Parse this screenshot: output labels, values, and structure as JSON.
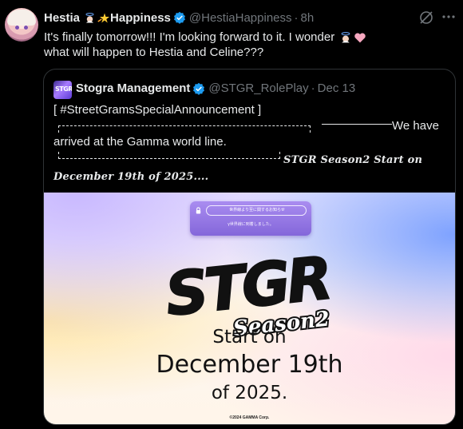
{
  "tweet": {
    "display_name_part1": "Hestia",
    "display_name_part2": "Happiness",
    "handle": "@HestiaHappiness",
    "separator": "·",
    "time": "8h",
    "text_line1": "It's finally tomorrow!!! I'm looking forward to it. I wonder",
    "text_line2": "what will happen to Hestia and Celine???",
    "icons": [
      "angel-emoji-icon",
      "star-emoji-icon",
      "verified-badge-icon",
      "grok-icon",
      "more-icon",
      "pink-heart-emoji-icon"
    ]
  },
  "quote": {
    "avatar_text": "STGR",
    "display_name": "Stogra Management",
    "handle": "@STGR_RolePlay",
    "separator": "·",
    "date": "Dec 13",
    "line1": "[ #StreetGramsSpecialAnnouncement ]",
    "line2a": "We have",
    "line2b": "arrived at the Gamma world line.",
    "fancy_line1": "STGR Season2 Start on",
    "fancy_line2": "December 19th of 2025....",
    "media": {
      "notice_pill_text": "世界線より至に関するお知らせ",
      "notice_text": "γ世界線に到着しました。",
      "logo_text": "STGR",
      "logo_sub": "Season2",
      "start_line1": "Start on",
      "start_line2": "December 19th",
      "start_line3": "of 2025.",
      "copyright": "©2024 GAMMA Corp."
    }
  },
  "colors": {
    "background": "#000000",
    "text": "#e7e9ea",
    "muted": "#71767b",
    "verified": "#1d9bf0",
    "border": "#2f3336",
    "notice_purple": "#8467da"
  }
}
